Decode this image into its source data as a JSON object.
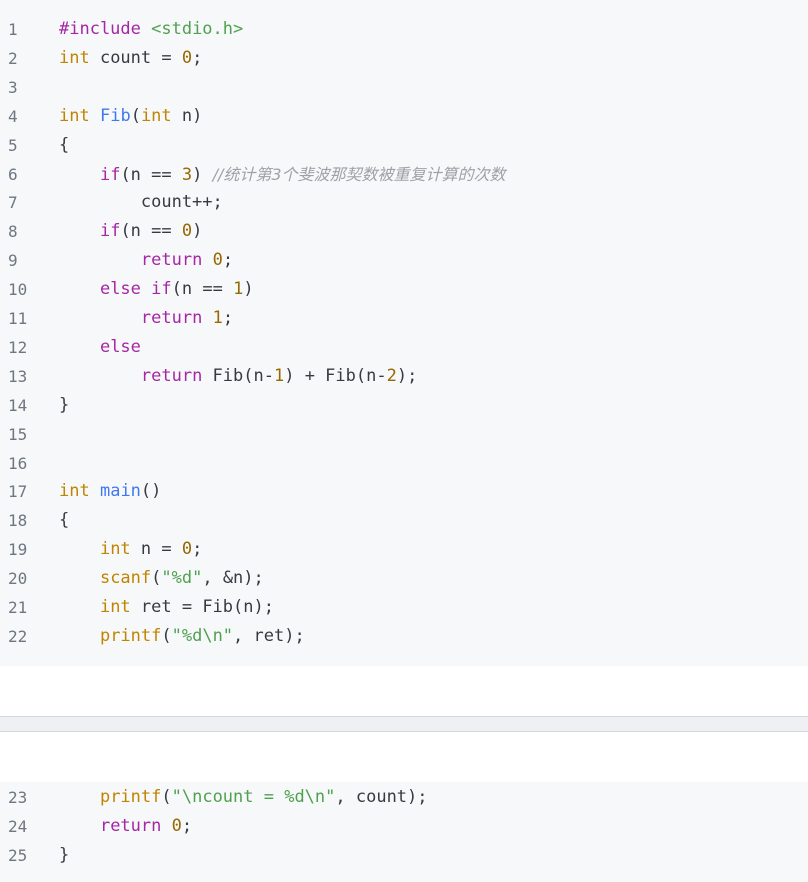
{
  "code_top": [
    {
      "n": "1",
      "tokens": [
        {
          "t": "#include ",
          "c": "pp"
        },
        {
          "t": "<stdio.h>",
          "c": "str"
        }
      ]
    },
    {
      "n": "2",
      "tokens": [
        {
          "t": "int",
          "c": "ty"
        },
        {
          "t": " count = ",
          "c": "pl"
        },
        {
          "t": "0",
          "c": "num"
        },
        {
          "t": ";",
          "c": "pl"
        }
      ]
    },
    {
      "n": "3",
      "tokens": []
    },
    {
      "n": "4",
      "tokens": [
        {
          "t": "int",
          "c": "ty"
        },
        {
          "t": " ",
          "c": "pl"
        },
        {
          "t": "Fib",
          "c": "fn"
        },
        {
          "t": "(",
          "c": "pl"
        },
        {
          "t": "int",
          "c": "ty"
        },
        {
          "t": " n)",
          "c": "pl"
        }
      ]
    },
    {
      "n": "5",
      "tokens": [
        {
          "t": "{",
          "c": "pl"
        }
      ]
    },
    {
      "n": "6",
      "tokens": [
        {
          "t": "    ",
          "c": "pl"
        },
        {
          "t": "if",
          "c": "kw"
        },
        {
          "t": "(n == ",
          "c": "pl"
        },
        {
          "t": "3",
          "c": "num"
        },
        {
          "t": ") ",
          "c": "pl"
        },
        {
          "t": "//统计第3个斐波那契数被重复计算的次数",
          "c": "cm"
        }
      ]
    },
    {
      "n": "7",
      "tokens": [
        {
          "t": "        count++;",
          "c": "pl"
        }
      ]
    },
    {
      "n": "8",
      "tokens": [
        {
          "t": "    ",
          "c": "pl"
        },
        {
          "t": "if",
          "c": "kw"
        },
        {
          "t": "(n == ",
          "c": "pl"
        },
        {
          "t": "0",
          "c": "num"
        },
        {
          "t": ")",
          "c": "pl"
        }
      ]
    },
    {
      "n": "9",
      "tokens": [
        {
          "t": "        ",
          "c": "pl"
        },
        {
          "t": "return",
          "c": "kw"
        },
        {
          "t": " ",
          "c": "pl"
        },
        {
          "t": "0",
          "c": "num"
        },
        {
          "t": ";",
          "c": "pl"
        }
      ]
    },
    {
      "n": "10",
      "tokens": [
        {
          "t": "    ",
          "c": "pl"
        },
        {
          "t": "else",
          "c": "kw"
        },
        {
          "t": " ",
          "c": "pl"
        },
        {
          "t": "if",
          "c": "kw"
        },
        {
          "t": "(n == ",
          "c": "pl"
        },
        {
          "t": "1",
          "c": "num"
        },
        {
          "t": ")",
          "c": "pl"
        }
      ]
    },
    {
      "n": "11",
      "tokens": [
        {
          "t": "        ",
          "c": "pl"
        },
        {
          "t": "return",
          "c": "kw"
        },
        {
          "t": " ",
          "c": "pl"
        },
        {
          "t": "1",
          "c": "num"
        },
        {
          "t": ";",
          "c": "pl"
        }
      ]
    },
    {
      "n": "12",
      "tokens": [
        {
          "t": "    ",
          "c": "pl"
        },
        {
          "t": "else",
          "c": "kw"
        }
      ]
    },
    {
      "n": "13",
      "tokens": [
        {
          "t": "        ",
          "c": "pl"
        },
        {
          "t": "return",
          "c": "kw"
        },
        {
          "t": " Fib(n-",
          "c": "pl"
        },
        {
          "t": "1",
          "c": "num"
        },
        {
          "t": ") + Fib(n-",
          "c": "pl"
        },
        {
          "t": "2",
          "c": "num"
        },
        {
          "t": ");",
          "c": "pl"
        }
      ]
    },
    {
      "n": "14",
      "tokens": [
        {
          "t": "}",
          "c": "pl"
        }
      ]
    },
    {
      "n": "15",
      "tokens": []
    },
    {
      "n": "16",
      "tokens": []
    },
    {
      "n": "17",
      "tokens": [
        {
          "t": "int",
          "c": "ty"
        },
        {
          "t": " ",
          "c": "pl"
        },
        {
          "t": "main",
          "c": "fn"
        },
        {
          "t": "()",
          "c": "pl"
        }
      ]
    },
    {
      "n": "18",
      "tokens": [
        {
          "t": "{",
          "c": "pl"
        }
      ]
    },
    {
      "n": "19",
      "tokens": [
        {
          "t": "    ",
          "c": "pl"
        },
        {
          "t": "int",
          "c": "ty"
        },
        {
          "t": " n = ",
          "c": "pl"
        },
        {
          "t": "0",
          "c": "num"
        },
        {
          "t": ";",
          "c": "pl"
        }
      ]
    },
    {
      "n": "20",
      "tokens": [
        {
          "t": "    ",
          "c": "pl"
        },
        {
          "t": "scanf",
          "c": "ty"
        },
        {
          "t": "(",
          "c": "pl"
        },
        {
          "t": "\"%d\"",
          "c": "str"
        },
        {
          "t": ", &n);",
          "c": "pl"
        }
      ]
    },
    {
      "n": "21",
      "tokens": [
        {
          "t": "    ",
          "c": "pl"
        },
        {
          "t": "int",
          "c": "ty"
        },
        {
          "t": " ret = Fib(n);",
          "c": "pl"
        }
      ]
    },
    {
      "n": "22",
      "tokens": [
        {
          "t": "    ",
          "c": "pl"
        },
        {
          "t": "printf",
          "c": "ty"
        },
        {
          "t": "(",
          "c": "pl"
        },
        {
          "t": "\"%d\\n\"",
          "c": "str"
        },
        {
          "t": ", ret);",
          "c": "pl"
        }
      ]
    }
  ],
  "code_bottom": [
    {
      "n": "23",
      "tokens": [
        {
          "t": "    ",
          "c": "pl"
        },
        {
          "t": "printf",
          "c": "ty"
        },
        {
          "t": "(",
          "c": "pl"
        },
        {
          "t": "\"\\ncount = %d\\n\"",
          "c": "str"
        },
        {
          "t": ", count);",
          "c": "pl"
        }
      ]
    },
    {
      "n": "24",
      "tokens": [
        {
          "t": "    ",
          "c": "pl"
        },
        {
          "t": "return",
          "c": "kw"
        },
        {
          "t": " ",
          "c": "pl"
        },
        {
          "t": "0",
          "c": "num"
        },
        {
          "t": ";",
          "c": "pl"
        }
      ]
    },
    {
      "n": "25",
      "tokens": [
        {
          "t": "}",
          "c": "pl"
        }
      ]
    }
  ],
  "colors": {
    "keyword": "#a626a4",
    "type": "#c18401",
    "function": "#4078f2",
    "number": "#986801",
    "string": "#50a14f",
    "comment": "#a0a1a7",
    "background": "#f6f8fa"
  }
}
